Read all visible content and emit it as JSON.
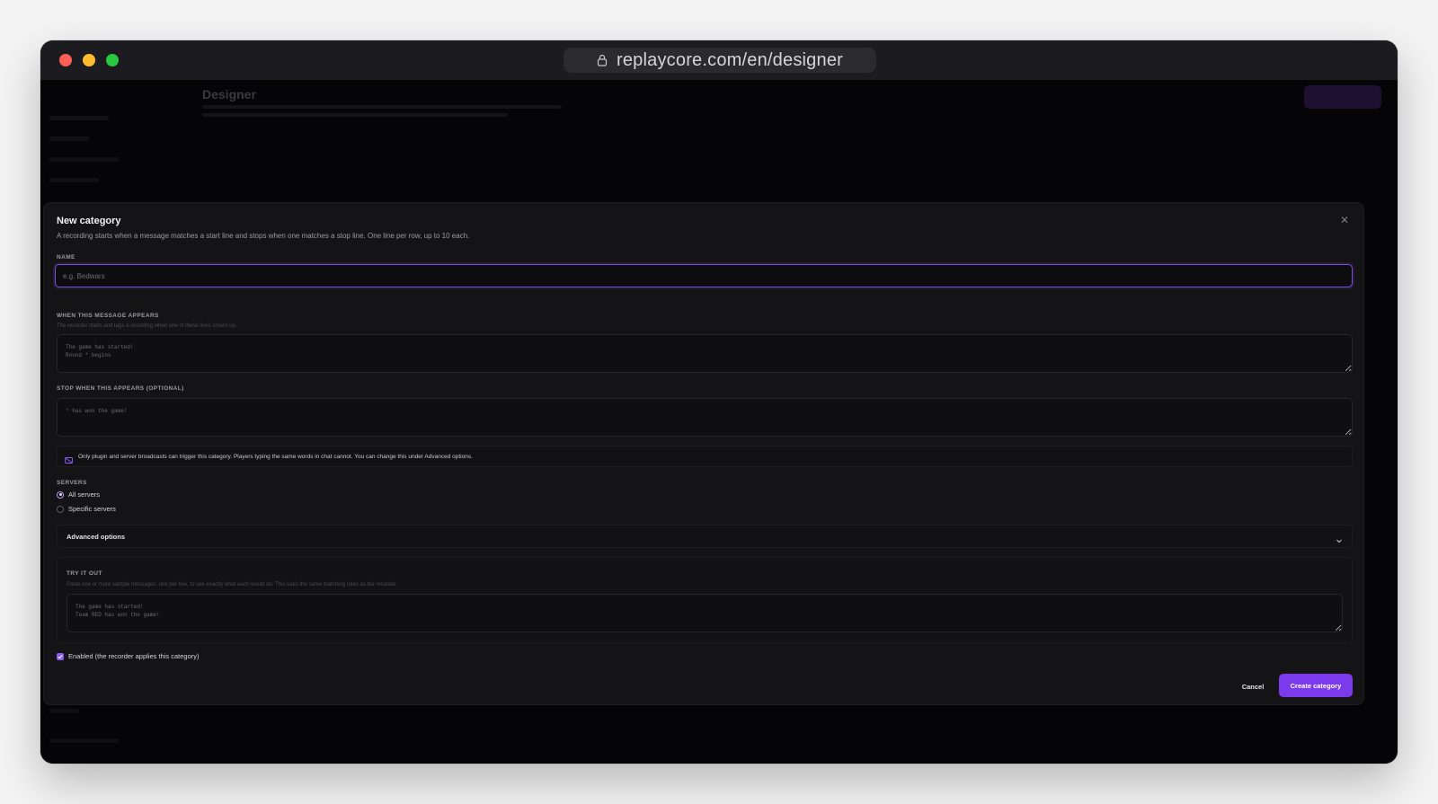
{
  "browser": {
    "url": "replaycore.com/en/designer"
  },
  "background": {
    "page_title": "Designer"
  },
  "modal": {
    "title": "New category",
    "description": "A recording starts when a message matches a start line and stops when one matches a stop line. One line per row, up to 10 each.",
    "name": {
      "label": "NAME",
      "placeholder": "e.g. Bedwars",
      "value": ""
    },
    "start": {
      "label": "WHEN THIS MESSAGE APPEARS",
      "hint": "The recorder starts and tags a recording when one of these lines shows up.",
      "placeholder": "The game has started!\nRound * begins"
    },
    "stop": {
      "label": "STOP WHEN THIS APPEARS (OPTIONAL)",
      "placeholder": "* has won the game!"
    },
    "notice": "Only plugin and server broadcasts can trigger this category. Players typing the same words in chat cannot. You can change this under Advanced options.",
    "servers": {
      "label": "SERVERS",
      "options": [
        {
          "label": "All servers",
          "checked": true
        },
        {
          "label": "Specific servers",
          "checked": false
        }
      ]
    },
    "advanced_label": "Advanced options",
    "try": {
      "label": "TRY IT OUT",
      "hint": "Paste one or more sample messages, one per line, to see exactly what each would do. This uses the same matching rules as the recorder.",
      "placeholder": "The game has started!\nTeam RED has won the game!"
    },
    "enabled_label": "Enabled (the recorder applies this category)",
    "cancel_label": "Cancel",
    "create_label": "Create category"
  },
  "colors": {
    "accent": "#7c3aed",
    "focus_ring": "#7c4ddb"
  }
}
